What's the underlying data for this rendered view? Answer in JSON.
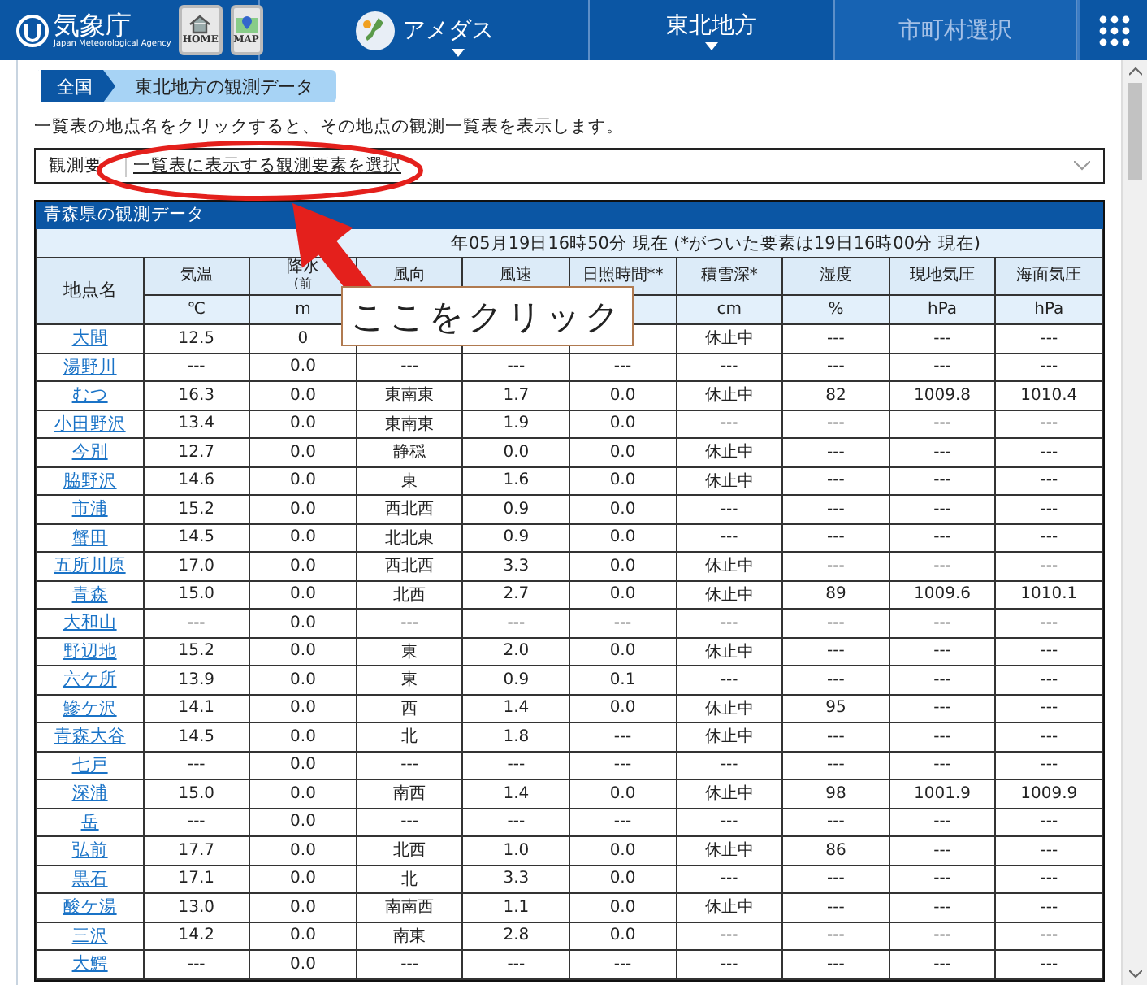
{
  "nav": {
    "logo_text": "気象庁",
    "logo_subtitle": "Japan Meteorological Agency",
    "buttons": [
      {
        "label": "HOME",
        "kind": "home"
      },
      {
        "label": "MAP",
        "kind": "map"
      }
    ],
    "items": [
      {
        "label": "アメダス",
        "kind": "amedas",
        "caret": true,
        "disabled": false
      },
      {
        "label": "東北地方",
        "kind": "plain",
        "caret": true,
        "disabled": false
      },
      {
        "label": "市町村選択",
        "kind": "plain",
        "caret": false,
        "disabled": true
      }
    ]
  },
  "breadcrumb": [
    {
      "label": "全国",
      "selected": false
    },
    {
      "label": "東北地方の観測データ",
      "selected": true
    }
  ],
  "description": "一覧表の地点名をクリックすると、その地点の観測一覧表を表示します。",
  "element_select": {
    "label": "観測要",
    "link": "一覧表に表示する観測要素を選択"
  },
  "table": {
    "title": "青森県の観測データ",
    "timestamp": "年05月19日16時50分 現在 (*がついた要素は19日16時00分 現在)",
    "station_header": "地点名",
    "columns": [
      {
        "label": "気温",
        "unit": "℃"
      },
      {
        "label": "降水",
        "note": "(前",
        "unit": "m"
      },
      {
        "label": "風向"
      },
      {
        "label": "風速"
      },
      {
        "label": "日照時間**"
      },
      {
        "label": "積雪深*",
        "unit": "cm"
      },
      {
        "label": "湿度",
        "unit": "%"
      },
      {
        "label": "現地気圧",
        "unit": "hPa"
      },
      {
        "label": "海面気圧",
        "unit": "hPa"
      }
    ],
    "rows": [
      {
        "station": "大間",
        "cells": [
          "12.5",
          "0",
          null,
          null,
          null,
          "休止中",
          "---",
          "---",
          "---"
        ]
      },
      {
        "station": "湯野川",
        "cells": [
          "---",
          "0.0",
          "---",
          "---",
          "---",
          "---",
          "---",
          "---",
          "---"
        ]
      },
      {
        "station": "むつ",
        "cells": [
          "16.3",
          "0.0",
          "東南東",
          "1.7",
          "0.0",
          "休止中",
          "82",
          "1009.8",
          "1010.4"
        ]
      },
      {
        "station": "小田野沢",
        "cells": [
          "13.4",
          "0.0",
          "東南東",
          "1.9",
          "0.0",
          "---",
          "---",
          "---",
          "---"
        ]
      },
      {
        "station": "今別",
        "cells": [
          "12.7",
          "0.0",
          "静穏",
          "0.0",
          "0.0",
          "休止中",
          "---",
          "---",
          "---"
        ]
      },
      {
        "station": "脇野沢",
        "cells": [
          "14.6",
          "0.0",
          "東",
          "1.6",
          "0.0",
          "休止中",
          "---",
          "---",
          "---"
        ]
      },
      {
        "station": "市浦",
        "cells": [
          "15.2",
          "0.0",
          "西北西",
          "0.9",
          "0.0",
          "---",
          "---",
          "---",
          "---"
        ]
      },
      {
        "station": "蟹田",
        "cells": [
          "14.5",
          "0.0",
          "北北東",
          "0.9",
          "0.0",
          "---",
          "---",
          "---",
          "---"
        ]
      },
      {
        "station": "五所川原",
        "cells": [
          "17.0",
          "0.0",
          "西北西",
          "3.3",
          "0.0",
          "休止中",
          "---",
          "---",
          "---"
        ]
      },
      {
        "station": "青森",
        "cells": [
          "15.0",
          "0.0",
          "北西",
          "2.7",
          "0.0",
          "休止中",
          "89",
          "1009.6",
          "1010.1"
        ]
      },
      {
        "station": "大和山",
        "cells": [
          "---",
          "0.0",
          "---",
          "---",
          "---",
          "---",
          "---",
          "---",
          "---"
        ]
      },
      {
        "station": "野辺地",
        "cells": [
          "15.2",
          "0.0",
          "東",
          "2.0",
          "0.0",
          "休止中",
          "---",
          "---",
          "---"
        ]
      },
      {
        "station": "六ケ所",
        "cells": [
          "13.9",
          "0.0",
          "東",
          "0.9",
          "0.1",
          "---",
          "---",
          "---",
          "---"
        ]
      },
      {
        "station": "鰺ケ沢",
        "cells": [
          "14.1",
          "0.0",
          "西",
          "1.4",
          "0.0",
          "休止中",
          "95",
          "---",
          "---"
        ]
      },
      {
        "station": "青森大谷",
        "cells": [
          "14.5",
          "0.0",
          "北",
          "1.8",
          "---",
          "休止中",
          "---",
          "---",
          "---"
        ]
      },
      {
        "station": "七戸",
        "cells": [
          "---",
          "0.0",
          "---",
          "---",
          "---",
          "---",
          "---",
          "---",
          "---"
        ]
      },
      {
        "station": "深浦",
        "cells": [
          "15.0",
          "0.0",
          "南西",
          "1.4",
          "0.0",
          "休止中",
          "98",
          "1001.9",
          "1009.9"
        ]
      },
      {
        "station": "岳",
        "cells": [
          "---",
          "0.0",
          "---",
          "---",
          "---",
          "---",
          "---",
          "---",
          "---"
        ]
      },
      {
        "station": "弘前",
        "cells": [
          "17.7",
          "0.0",
          "北西",
          "1.0",
          "0.0",
          "休止中",
          "86",
          "---",
          "---"
        ]
      },
      {
        "station": "黒石",
        "cells": [
          "17.1",
          "0.0",
          "北",
          "3.3",
          "0.0",
          "---",
          "---",
          "---",
          "---"
        ]
      },
      {
        "station": "酸ケ湯",
        "cells": [
          "13.0",
          "0.0",
          "南南西",
          "1.1",
          "0.0",
          "休止中",
          "---",
          "---",
          "---"
        ]
      },
      {
        "station": "三沢",
        "cells": [
          "14.2",
          "0.0",
          "南東",
          "2.8",
          "0.0",
          "---",
          "---",
          "---",
          "---"
        ]
      },
      {
        "station": "大鰐",
        "cells": [
          "---",
          "0.0",
          "---",
          "---",
          "---",
          "---",
          "---",
          "---",
          "---"
        ]
      }
    ]
  },
  "annotation": {
    "callout": "ここをクリック"
  }
}
